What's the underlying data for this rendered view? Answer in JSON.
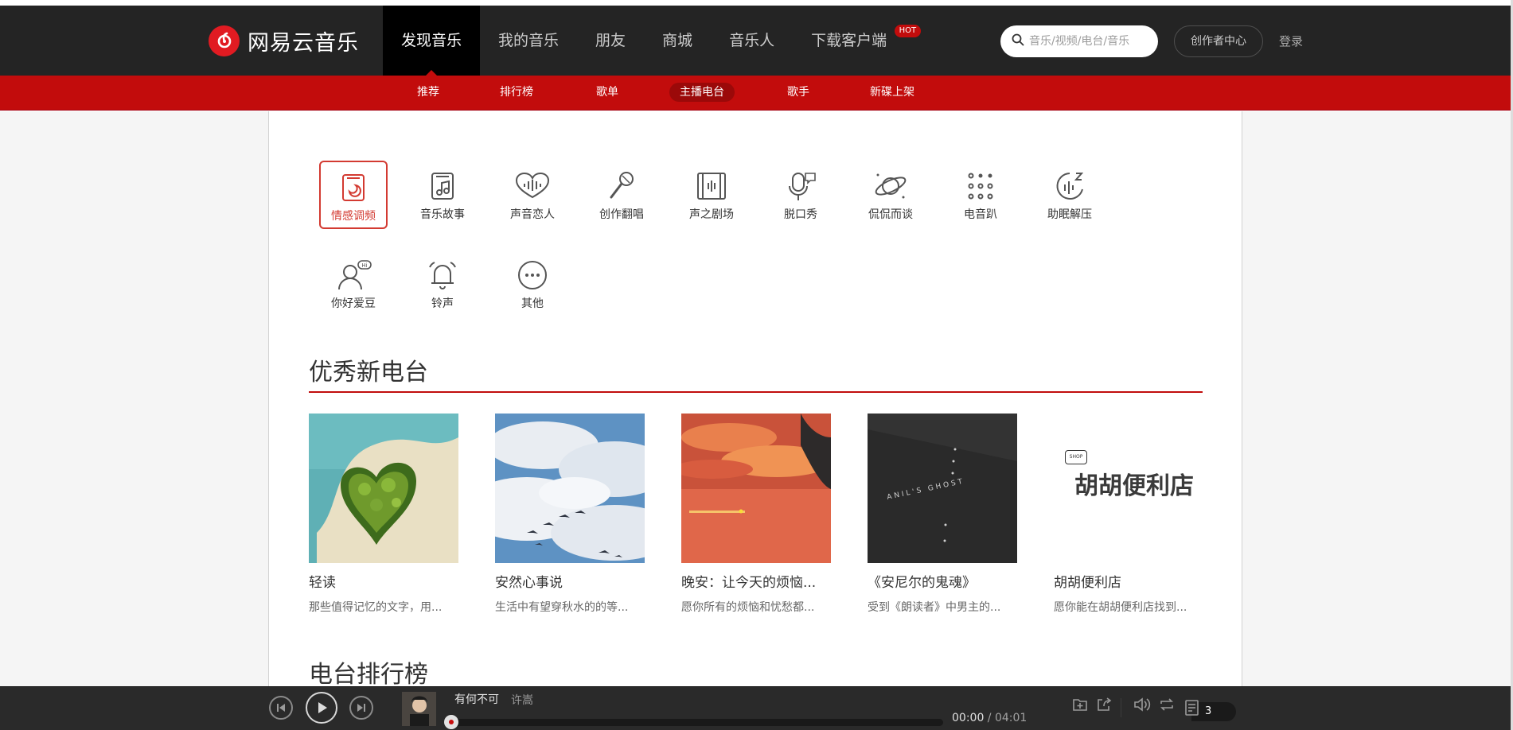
{
  "brand": {
    "name": "网易云音乐",
    "accent": "#c20c0c"
  },
  "topnav": [
    {
      "label": "发现音乐",
      "active": true
    },
    {
      "label": "我的音乐"
    },
    {
      "label": "朋友"
    },
    {
      "label": "商城"
    },
    {
      "label": "音乐人"
    },
    {
      "label": "下载客户端",
      "badge": "HOT"
    }
  ],
  "search": {
    "placeholder": "音乐/视频/电台/音乐",
    "icon": "search-icon"
  },
  "creator_label": "创作者中心",
  "login_label": "登录",
  "subnav": [
    {
      "label": "推荐"
    },
    {
      "label": "排行榜"
    },
    {
      "label": "歌单"
    },
    {
      "label": "主播电台",
      "active": true
    },
    {
      "label": "歌手"
    },
    {
      "label": "新碟上架"
    }
  ],
  "categories": [
    {
      "label": "情感调频",
      "icon": "emotion-radio-icon",
      "active": true
    },
    {
      "label": "音乐故事",
      "icon": "music-story-icon"
    },
    {
      "label": "声音恋人",
      "icon": "voice-lover-icon"
    },
    {
      "label": "创作翻唱",
      "icon": "microphone-icon"
    },
    {
      "label": "声之剧场",
      "icon": "theater-icon"
    },
    {
      "label": "脱口秀",
      "icon": "talkshow-icon"
    },
    {
      "label": "侃侃而谈",
      "icon": "planet-talk-icon"
    },
    {
      "label": "电音趴",
      "icon": "electronic-dots-icon"
    },
    {
      "label": "助眠解压",
      "icon": "sleep-moon-icon"
    },
    {
      "label": "你好爱豆",
      "icon": "idol-hi-icon"
    },
    {
      "label": "铃声",
      "icon": "bell-icon"
    },
    {
      "label": "其他",
      "icon": "more-icon"
    }
  ],
  "sections": {
    "new_stations": "优秀新电台",
    "ranking": "电台排行榜"
  },
  "stations": [
    {
      "title": "轻读",
      "desc": "那些值得记忆的文字，用..."
    },
    {
      "title": "安然心事说",
      "desc": "生活中有望穿秋水的的等..."
    },
    {
      "title": "晚安：让今天的烦恼...",
      "desc": "愿你所有的烦恼和忧愁都..."
    },
    {
      "title": "《安尼尔的鬼魂》",
      "desc": "受到《朗读者》中男主的..."
    },
    {
      "title": "胡胡便利店",
      "desc": "愿你能在胡胡便利店找到..."
    }
  ],
  "station_images": {
    "cover4_text": "ANIL'S GHOST",
    "cover5_text": "胡胡便利店",
    "cover5_badge": "SHOP"
  },
  "player": {
    "song": "有何不可",
    "artist": "许嵩",
    "current": "00:00",
    "separator": " / ",
    "total": "04:01",
    "progress": 0,
    "playlist_count": "3"
  }
}
